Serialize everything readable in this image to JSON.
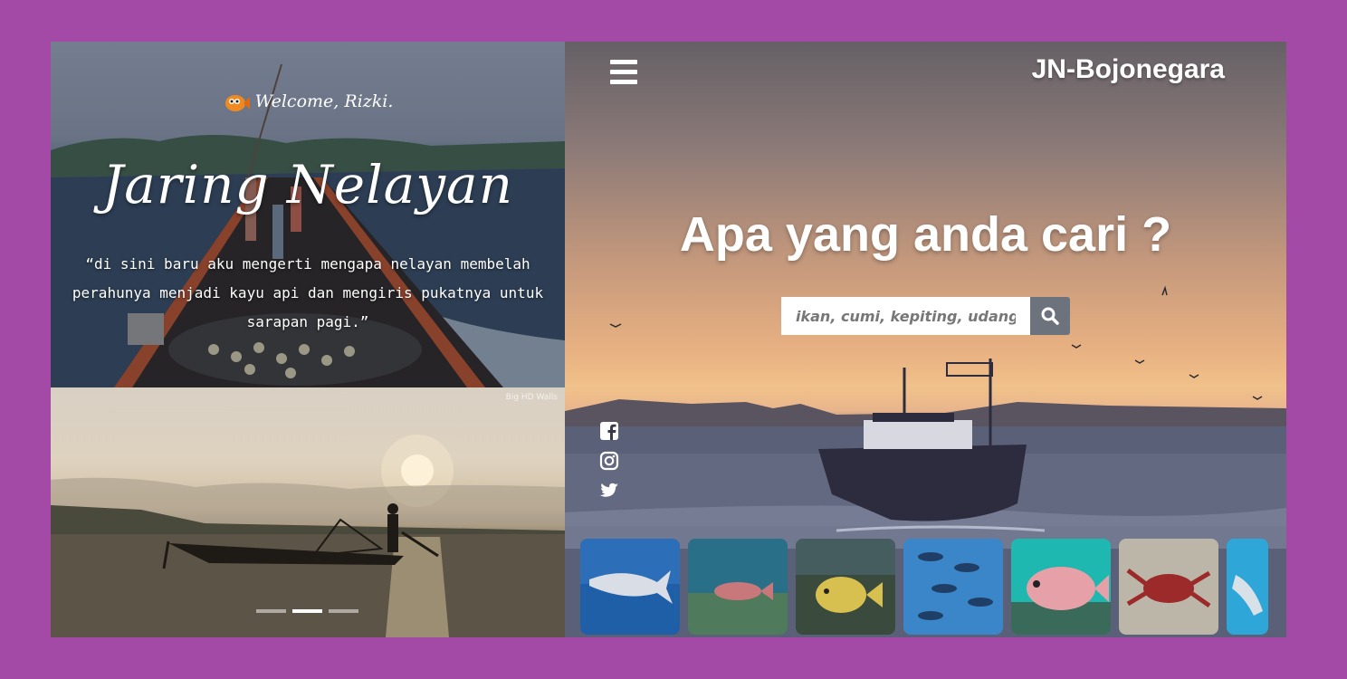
{
  "left": {
    "welcome": "Welcome, Rizki.",
    "title": "Jaring Nelayan",
    "quote": "“di sini baru aku mengerti mengapa nelayan membelah perahunya menjadi kayu api dan mengiris pukatnya untuk sarapan pagi.”",
    "watermark": "Big HD Walls",
    "carousel": {
      "count": 3,
      "active_index": 1
    }
  },
  "header": {
    "menu_icon": "hamburger-icon",
    "site_name": "JN-Bojonegara"
  },
  "main": {
    "headline": "Apa yang anda cari ?",
    "search": {
      "placeholder": "ikan, cumi, kepiting, udang ?",
      "button_icon": "search-icon"
    }
  },
  "social": [
    {
      "name": "facebook-icon"
    },
    {
      "name": "instagram-icon"
    },
    {
      "name": "twitter-icon"
    }
  ],
  "thumbnails": [
    {
      "name": "tuna"
    },
    {
      "name": "coral-fish"
    },
    {
      "name": "rabbitfish"
    },
    {
      "name": "tuna-school"
    },
    {
      "name": "snapper"
    },
    {
      "name": "lobster"
    },
    {
      "name": "shark"
    }
  ],
  "colors": {
    "page_bg": "#a24aa5",
    "search_button": "#6c737c",
    "text": "#ffffff"
  }
}
